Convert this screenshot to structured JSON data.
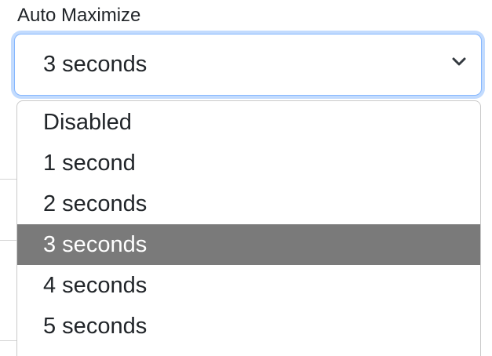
{
  "field": {
    "label": "Auto Maximize",
    "selected_value": "3 seconds",
    "icon": "chevron-down-icon"
  },
  "dropdown": {
    "selected_index": 3,
    "options": [
      {
        "label": "Disabled"
      },
      {
        "label": "1 second"
      },
      {
        "label": "2 seconds"
      },
      {
        "label": "3 seconds"
      },
      {
        "label": "4 seconds"
      },
      {
        "label": "5 seconds"
      }
    ]
  },
  "colors": {
    "focus_border": "#86b7fe",
    "focus_ring": "#0d6efd",
    "highlight_bg": "#7a7a7a",
    "text": "#212529"
  }
}
